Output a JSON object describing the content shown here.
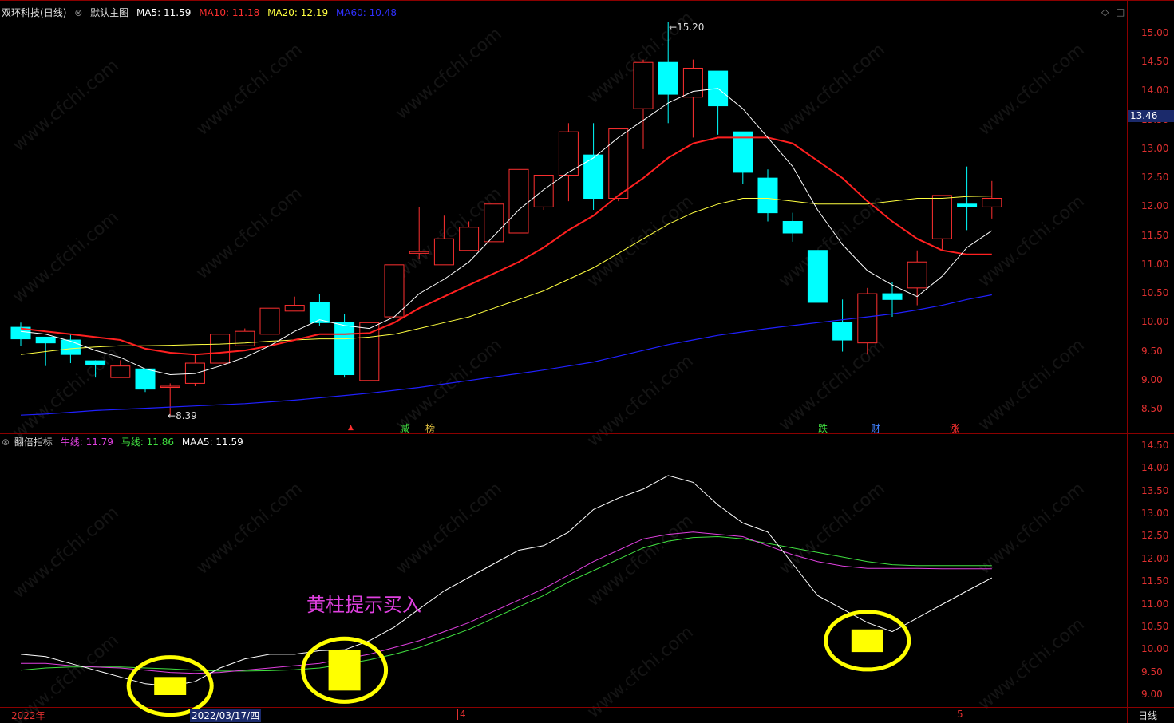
{
  "main_header": {
    "stock": "双环科技",
    "period": "(日线)",
    "template": "默认主图",
    "ma5": "MA5: 11.59",
    "ma10": "MA10: 11.18",
    "ma20": "MA20: 12.19",
    "ma60": "MA60: 10.48"
  },
  "sub_header": {
    "name": "翻倍指标",
    "niu": "牛线: 11.79",
    "ma": "马线: 11.86",
    "maa5": "MAA5: 11.59"
  },
  "price_axis": [
    "15.00",
    "14.50",
    "14.00",
    "13.50",
    "13.00",
    "12.50",
    "12.00",
    "11.50",
    "11.00",
    "10.50",
    "10.00",
    "9.50",
    "9.00",
    "8.50"
  ],
  "indicator_axis": [
    "14.50",
    "14.00",
    "13.50",
    "13.00",
    "12.50",
    "12.00",
    "11.50",
    "11.00",
    "10.50",
    "10.00",
    "9.50",
    "9.00"
  ],
  "current_price": "13.46",
  "high_label": "15.20",
  "low_label": "8.39",
  "annotation": "黄柱提示买入",
  "events": [
    "减",
    "榜",
    "跌",
    "财",
    "涨"
  ],
  "bottom": {
    "year": "2022年",
    "date": "2022/03/17/四",
    "m4": "4",
    "m5": "5",
    "period": "日线"
  },
  "watermark": "www.cfchi.com",
  "colors": {
    "up": "#ff3030",
    "down": "#00ffff",
    "ma5": "#ffffff",
    "ma10": "#ff2020",
    "ma20": "#ffff40",
    "ma60": "#2020ff",
    "niu": "#e040e0",
    "ma": "#40e040",
    "maa5": "#ffffff",
    "buy_bar": "#ffff00",
    "circle": "#ffff00"
  },
  "chart_data": {
    "type": "candlestick",
    "candles": [
      {
        "o": 9.92,
        "c": 9.72,
        "h": 10.0,
        "l": 9.6
      },
      {
        "o": 9.75,
        "c": 9.65,
        "h": 9.75,
        "l": 9.25
      },
      {
        "o": 9.7,
        "c": 9.45,
        "h": 9.8,
        "l": 9.3
      },
      {
        "o": 9.34,
        "c": 9.28,
        "h": 9.35,
        "l": 9.05
      },
      {
        "o": 9.05,
        "c": 9.25,
        "h": 9.35,
        "l": 9.05
      },
      {
        "o": 9.2,
        "c": 8.85,
        "h": 9.2,
        "l": 8.8
      },
      {
        "o": 8.9,
        "c": 8.9,
        "h": 8.95,
        "l": 8.39
      },
      {
        "o": 8.95,
        "c": 9.3,
        "h": 9.45,
        "l": 8.9
      },
      {
        "o": 9.3,
        "c": 9.8,
        "h": 9.8,
        "l": 9.3
      },
      {
        "o": 9.6,
        "c": 9.85,
        "h": 9.9,
        "l": 9.6
      },
      {
        "o": 9.8,
        "c": 10.25,
        "h": 10.25,
        "l": 9.8
      },
      {
        "o": 10.2,
        "c": 10.3,
        "h": 10.45,
        "l": 10.2
      },
      {
        "o": 10.35,
        "c": 10.0,
        "h": 10.5,
        "l": 9.95
      },
      {
        "o": 10.0,
        "c": 9.1,
        "h": 10.15,
        "l": 9.05
      },
      {
        "o": 9.0,
        "c": 10.0,
        "h": 10.0,
        "l": 9.0
      },
      {
        "o": 10.1,
        "c": 11.0,
        "h": 11.0,
        "l": 10.1
      },
      {
        "o": 11.2,
        "c": 11.23,
        "h": 12.0,
        "l": 11.1
      },
      {
        "o": 11.0,
        "c": 11.45,
        "h": 11.85,
        "l": 11.0
      },
      {
        "o": 11.25,
        "c": 11.65,
        "h": 11.75,
        "l": 11.25
      },
      {
        "o": 11.4,
        "c": 12.05,
        "h": 12.05,
        "l": 11.4
      },
      {
        "o": 11.55,
        "c": 12.65,
        "h": 12.65,
        "l": 11.55
      },
      {
        "o": 12.0,
        "c": 12.55,
        "h": 12.55,
        "l": 11.95
      },
      {
        "o": 12.55,
        "c": 13.3,
        "h": 13.45,
        "l": 12.1
      },
      {
        "o": 12.9,
        "c": 12.15,
        "h": 13.45,
        "l": 11.95
      },
      {
        "o": 12.15,
        "c": 13.35,
        "h": 13.35,
        "l": 12.1
      },
      {
        "o": 13.7,
        "c": 14.5,
        "h": 14.55,
        "l": 13.0
      },
      {
        "o": 14.5,
        "c": 13.95,
        "h": 15.2,
        "l": 13.45
      },
      {
        "o": 13.9,
        "c": 14.4,
        "h": 14.55,
        "l": 13.2
      },
      {
        "o": 14.35,
        "c": 13.75,
        "h": 14.35,
        "l": 13.25
      },
      {
        "o": 13.3,
        "c": 12.6,
        "h": 13.3,
        "l": 12.4
      },
      {
        "o": 12.5,
        "c": 11.9,
        "h": 12.65,
        "l": 11.75
      },
      {
        "o": 11.75,
        "c": 11.55,
        "h": 11.9,
        "l": 11.4
      },
      {
        "o": 11.25,
        "c": 10.35,
        "h": 11.25,
        "l": 10.35
      },
      {
        "o": 10.0,
        "c": 9.7,
        "h": 10.4,
        "l": 9.5
      },
      {
        "o": 9.65,
        "c": 10.5,
        "h": 10.6,
        "l": 9.45
      },
      {
        "o": 10.5,
        "c": 10.4,
        "h": 10.7,
        "l": 10.1
      },
      {
        "o": 10.6,
        "c": 11.05,
        "h": 11.25,
        "l": 10.3
      },
      {
        "o": 11.45,
        "c": 12.2,
        "h": 12.2,
        "l": 11.25
      },
      {
        "o": 12.05,
        "c": 12.0,
        "h": 12.7,
        "l": 11.6
      },
      {
        "o": 12.0,
        "c": 12.15,
        "h": 12.45,
        "l": 11.8
      }
    ],
    "ma5": [
      9.85,
      9.8,
      9.68,
      9.52,
      9.4,
      9.2,
      9.1,
      9.12,
      9.25,
      9.4,
      9.6,
      9.85,
      10.05,
      9.95,
      9.9,
      10.1,
      10.5,
      10.75,
      11.05,
      11.5,
      11.95,
      12.3,
      12.6,
      12.85,
      13.2,
      13.5,
      13.8,
      14.0,
      14.05,
      13.7,
      13.2,
      12.7,
      11.95,
      11.35,
      10.9,
      10.65,
      10.45,
      10.8,
      11.3,
      11.59
    ],
    "ma10": [
      9.9,
      9.85,
      9.8,
      9.75,
      9.7,
      9.55,
      9.48,
      9.45,
      9.48,
      9.52,
      9.6,
      9.7,
      9.8,
      9.8,
      9.82,
      10.0,
      10.25,
      10.45,
      10.65,
      10.85,
      11.05,
      11.3,
      11.6,
      11.85,
      12.2,
      12.5,
      12.85,
      13.1,
      13.2,
      13.2,
      13.2,
      13.1,
      12.8,
      12.5,
      12.1,
      11.75,
      11.45,
      11.25,
      11.18,
      11.18
    ],
    "ma20": [
      9.45,
      9.5,
      9.55,
      9.58,
      9.6,
      9.6,
      9.61,
      9.62,
      9.63,
      9.65,
      9.68,
      9.7,
      9.72,
      9.72,
      9.75,
      9.8,
      9.9,
      10.0,
      10.1,
      10.25,
      10.4,
      10.55,
      10.75,
      10.95,
      11.2,
      11.45,
      11.7,
      11.9,
      12.05,
      12.15,
      12.15,
      12.1,
      12.05,
      12.05,
      12.05,
      12.1,
      12.15,
      12.15,
      12.18,
      12.19
    ],
    "ma60": [
      8.4,
      8.42,
      8.45,
      8.48,
      8.5,
      8.52,
      8.54,
      8.56,
      8.58,
      8.6,
      8.63,
      8.66,
      8.7,
      8.74,
      8.78,
      8.83,
      8.88,
      8.94,
      9.0,
      9.06,
      9.12,
      9.18,
      9.25,
      9.32,
      9.42,
      9.52,
      9.62,
      9.7,
      9.78,
      9.84,
      9.9,
      9.95,
      10.0,
      10.05,
      10.1,
      10.15,
      10.22,
      10.3,
      10.4,
      10.48
    ],
    "maa5": [
      9.9,
      9.85,
      9.7,
      9.55,
      9.4,
      9.25,
      9.2,
      9.3,
      9.6,
      9.8,
      9.9,
      9.9,
      9.98,
      10.0,
      10.2,
      10.5,
      10.9,
      11.3,
      11.6,
      11.9,
      12.2,
      12.3,
      12.6,
      13.1,
      13.35,
      13.55,
      13.85,
      13.7,
      13.2,
      12.8,
      12.6,
      11.9,
      11.2,
      10.9,
      10.6,
      10.4,
      10.7,
      11.0,
      11.3,
      11.59
    ],
    "niu": [
      9.7,
      9.7,
      9.65,
      9.62,
      9.6,
      9.55,
      9.5,
      9.48,
      9.5,
      9.55,
      9.6,
      9.65,
      9.7,
      9.8,
      9.9,
      10.05,
      10.2,
      10.4,
      10.6,
      10.85,
      11.1,
      11.35,
      11.65,
      11.95,
      12.2,
      12.45,
      12.55,
      12.6,
      12.55,
      12.5,
      12.3,
      12.1,
      11.95,
      11.85,
      11.8,
      11.8,
      11.8,
      11.79,
      11.79,
      11.79
    ],
    "ma": [
      9.55,
      9.6,
      9.62,
      9.62,
      9.62,
      9.6,
      9.58,
      9.55,
      9.53,
      9.53,
      9.54,
      9.56,
      9.6,
      9.68,
      9.78,
      9.9,
      10.05,
      10.25,
      10.45,
      10.7,
      10.95,
      11.2,
      11.5,
      11.75,
      12.0,
      12.25,
      12.4,
      12.48,
      12.5,
      12.45,
      12.35,
      12.25,
      12.15,
      12.05,
      11.95,
      11.88,
      11.86,
      11.86,
      11.86,
      11.86
    ],
    "buy_bars": [
      {
        "index": 6,
        "low": 9.0,
        "high": 9.4
      },
      {
        "index": 13,
        "low": 9.1,
        "high": 10.0
      },
      {
        "index": 34,
        "low": 9.95,
        "high": 10.45
      }
    ]
  }
}
